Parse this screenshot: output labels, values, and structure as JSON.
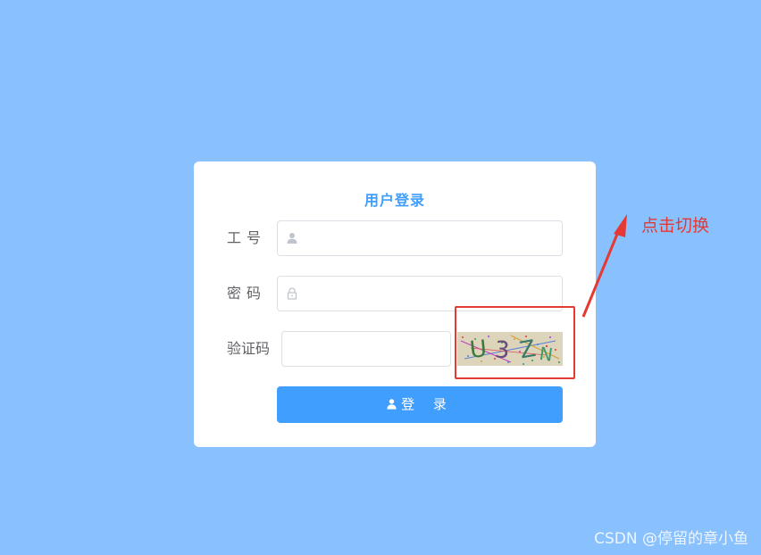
{
  "login": {
    "title": "用户登录",
    "employee_id": {
      "label": "工号",
      "value": ""
    },
    "password": {
      "label": "密码",
      "value": ""
    },
    "captcha": {
      "label": "验证码",
      "value": "",
      "image_text": [
        "U",
        "3",
        "Z",
        "N"
      ]
    },
    "submit_label": "登 录"
  },
  "annotation": {
    "text": "点击切换"
  },
  "watermark": "CSDN @停留的章小鱼",
  "colors": {
    "background": "#88c1fe",
    "primary": "#409eff",
    "annotation": "#e53935"
  },
  "icons": {
    "employee_id": "user-icon",
    "password": "lock-icon",
    "submit": "user-icon"
  }
}
